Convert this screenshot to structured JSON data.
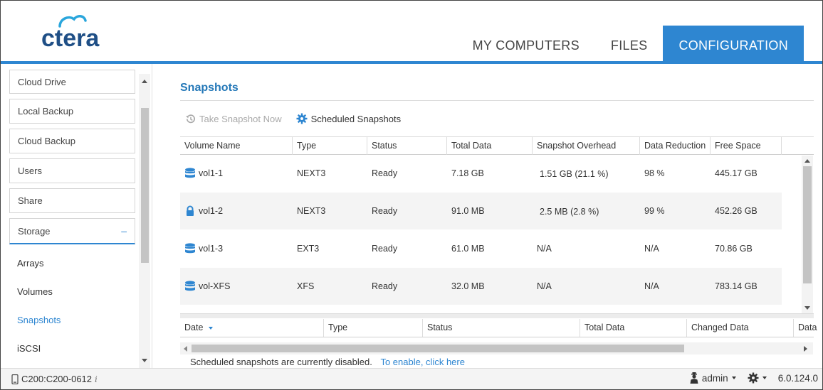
{
  "brand": {
    "logo_text": "ctera",
    "accent": "#2e86d1"
  },
  "nav": {
    "items": [
      {
        "label": "MY COMPUTERS",
        "active": false
      },
      {
        "label": "FILES",
        "active": false
      },
      {
        "label": "CONFIGURATION",
        "active": true
      }
    ]
  },
  "sidebar": {
    "buttons": [
      "Cloud Drive",
      "Local Backup",
      "Cloud Backup",
      "Users",
      "Share",
      "Storage"
    ],
    "storage_toggle": "–",
    "sub_items": [
      "Arrays",
      "Volumes",
      "Snapshots",
      "iSCSI"
    ],
    "active_sub": "Snapshots"
  },
  "page": {
    "title": "Snapshots",
    "toolbar": {
      "take_snapshot": "Take Snapshot Now",
      "scheduled": "Scheduled Snapshots"
    }
  },
  "volumes_table": {
    "columns": [
      "Volume Name",
      "Type",
      "Status",
      "Total Data",
      "Snapshot Overhead",
      "Data Reduction",
      "Free Space"
    ],
    "rows": [
      {
        "icon": "database-icon",
        "name": "vol1-1",
        "type": "NEXT3",
        "status": "Ready",
        "total": "7.18 GB",
        "overhead": "1.51 GB (21.1 %)",
        "reduction": "98 %",
        "free": "445.17 GB"
      },
      {
        "icon": "lock-icon",
        "name": "vol1-2",
        "type": "NEXT3",
        "status": "Ready",
        "total": "91.0 MB",
        "overhead": "2.5 MB (2.8 %)",
        "reduction": "99 %",
        "free": "452.26 GB"
      },
      {
        "icon": "database-icon",
        "name": "vol1-3",
        "type": "EXT3",
        "status": "Ready",
        "total": "61.0 MB",
        "overhead": "N/A",
        "reduction": "N/A",
        "free": "70.86 GB"
      },
      {
        "icon": "database-icon",
        "name": "vol-XFS",
        "type": "XFS",
        "status": "Ready",
        "total": "32.0 MB",
        "overhead": "N/A",
        "reduction": "N/A",
        "free": "783.14 GB"
      }
    ]
  },
  "snapshots_table": {
    "columns": [
      "Date",
      "Type",
      "Status",
      "Total Data",
      "Changed Data",
      "Data"
    ],
    "sort_column": "Date"
  },
  "notice": {
    "text": "Scheduled snapshots are currently disabled.",
    "link": "To enable, click here"
  },
  "footer": {
    "device": "C200:C200-0612",
    "info_glyph": "i",
    "user": "admin",
    "version": "6.0.124.0"
  }
}
